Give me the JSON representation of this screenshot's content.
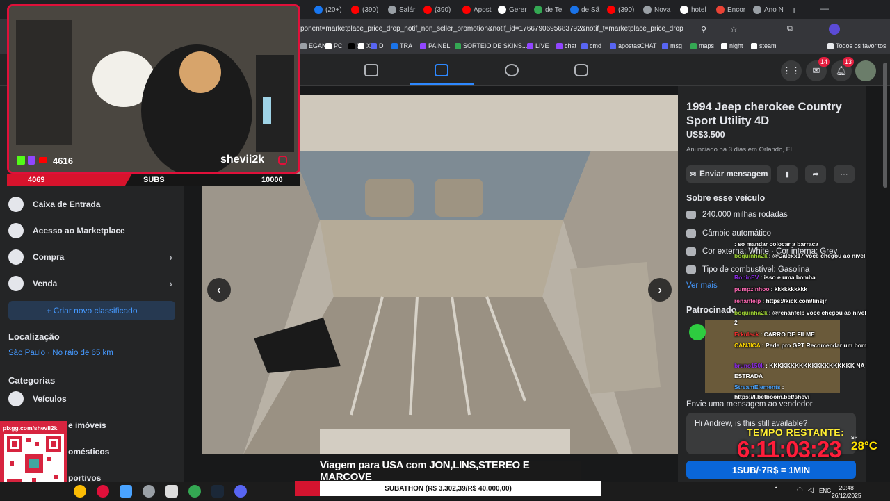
{
  "browser": {
    "tabs": [
      {
        "label": "(20+)",
        "color": "#1877f2"
      },
      {
        "label": "(390)",
        "color": "#ff0000"
      },
      {
        "label": "Salári",
        "color": "#9aa0a6"
      },
      {
        "label": "(390)",
        "color": "#ff0000"
      },
      {
        "label": "Apost",
        "color": "#ff0000"
      },
      {
        "label": "Gerer",
        "color": "#ffffff"
      },
      {
        "label": "de Te",
        "color": "#34a853"
      },
      {
        "label": "de Sã",
        "color": "#1a73e8"
      },
      {
        "label": "(390)",
        "color": "#ff0000"
      },
      {
        "label": "Nova",
        "color": "#9aa0a6"
      },
      {
        "label": "hotel",
        "color": "#ffffff"
      },
      {
        "label": "Encor",
        "color": "#ea4335"
      },
      {
        "label": "Ano N",
        "color": "#9aa0a6"
      }
    ],
    "url": "ponent=marketplace_price_drop_notif_non_seller_promotion&notif_id=1766790695683792&notif_t=marketplace_price_drop",
    "bookmarks": [
      {
        "label": "EGAN",
        "color": "#9aa0a6"
      },
      {
        "label": "PC",
        "color": "#ffffff"
      },
      {
        "label": "X",
        "color": "#000000"
      },
      {
        "label": "X",
        "color": "#ffffff"
      },
      {
        "label": "D",
        "color": "#5865f2"
      },
      {
        "label": "TRA",
        "color": "#1a73e8"
      },
      {
        "label": "PAINEL",
        "color": "#9146ff"
      },
      {
        "label": "SORTEIO DE SKINS...",
        "color": "#34a853"
      },
      {
        "label": "LIVE",
        "color": "#9146ff"
      },
      {
        "label": "chat",
        "color": "#9146ff"
      },
      {
        "label": "cmd",
        "color": "#5865f2"
      },
      {
        "label": "apostasCHAT",
        "color": "#5865f2"
      },
      {
        "label": "msg",
        "color": "#5865f2"
      },
      {
        "label": "maps",
        "color": "#34a853"
      },
      {
        "label": "night",
        "color": "#ffffff"
      },
      {
        "label": "steam",
        "color": "#ffffff"
      }
    ],
    "all_favorites": "Todos os favoritos"
  },
  "header": {
    "messenger_badge": "14",
    "notifications_badge": "13"
  },
  "sidebar": {
    "items": [
      {
        "label": "Caixa de Entrada",
        "icon": "inbox-icon"
      },
      {
        "label": "Acesso ao Marketplace",
        "icon": "user-shield-icon"
      },
      {
        "label": "Compra",
        "icon": "shopping-bag-icon"
      },
      {
        "label": "Venda",
        "icon": "tag-icon"
      }
    ],
    "new_listing": "+ Criar novo classificado",
    "location_title": "Localização",
    "location_value": "São Paulo · No raio de 65 km",
    "categories_title": "Categorias",
    "categories": [
      "Veículos",
      "e imóveis",
      "omésticos",
      "portivos"
    ]
  },
  "listing": {
    "title": "1994 Jeep cherokee Country Sport Utility 4D",
    "price": "US$3.500",
    "posted": "Anunciado há 3 dias em Orlando, FL",
    "send_message": "Enviar mensagem",
    "about_title": "Sobre esse veículo",
    "specs": [
      {
        "label": "240.000 milhas rodadas",
        "icon": "speedometer-icon"
      },
      {
        "label": "Câmbio automático",
        "icon": "gearbox-icon"
      },
      {
        "label": "Cor externa: White · Cor interna: Grey",
        "icon": "paint-icon"
      },
      {
        "label": "Tipo de combustível: Gasolina",
        "icon": "fuel-icon"
      }
    ],
    "see_more": "Ver mais",
    "sponsored": "Patrocinado",
    "send_seller": "Envie uma mensagem ao vendedor",
    "message_text": "Hi Andrew, is this still available?"
  },
  "stream": {
    "cam_handle": "shevii2k",
    "viewer_count": "4616",
    "subs_count": "4069",
    "subs_label": "SUBS",
    "subs_goal": "10000",
    "chat": [
      {
        "user": "",
        "user_color": "#8b8bff",
        "text": ": so mandar colocar a barraca"
      },
      {
        "user": "boquinha2k",
        "user_color": "#9acd32",
        "text": ": @Calexx17 você chegou ao nível"
      },
      {
        "user": "RoninEV",
        "user_color": "#8a2be2",
        "text": ": isso e uma bomba"
      },
      {
        "user": "pumpzinhoo",
        "user_color": "#ff69b4",
        "text": ": kkkkkkkkkk"
      },
      {
        "user": "renanfelp",
        "user_color": "#ff69b4",
        "text": ": https://kick.com/linsjr"
      },
      {
        "user": "boquinha2k",
        "user_color": "#9acd32",
        "text": ": @renanfelp você chegou ao nível"
      },
      {
        "user": "",
        "user_color": "#ffffff",
        "text": "2"
      },
      {
        "user": "Erkuleck",
        "user_color": "#ff3030",
        "text": ": CARRO DE FILME"
      },
      {
        "user": "CANJICA",
        "user_color": "#ffd700",
        "text": ": Pede pro GPT Recomendar um bom"
      },
      {
        "user": "bruno150k",
        "user_color": "#8a2be2",
        "text": ": KKKKKKKKKKKKKKKKKKKK NA"
      },
      {
        "user": "",
        "user_color": "#ffffff",
        "text": "ESTRADA"
      },
      {
        "user": "StreamElements",
        "user_color": "#4aa3ff",
        "text": ":"
      },
      {
        "user": "",
        "user_color": "#ffffff",
        "text": "https://l.betboom.bet/shevi"
      }
    ],
    "timer_label": "TEMPO RESTANTE:",
    "timer": "6:11:03:23",
    "temp_city": "SP",
    "temperature": "28°C",
    "sub_rate": "1SUB/·7R$ = 1MIN",
    "caption": "Viagem para USA com JON,LINS,STEREO E MARCOVE",
    "qr_label": "pixgg.com/shevii2k",
    "subathon": "SUBATHON (R$ 3.302,39/R$ 40.000,00)"
  },
  "taskbar": {
    "time": "20:48",
    "date": "26/12/2025",
    "lang": "ENG"
  }
}
